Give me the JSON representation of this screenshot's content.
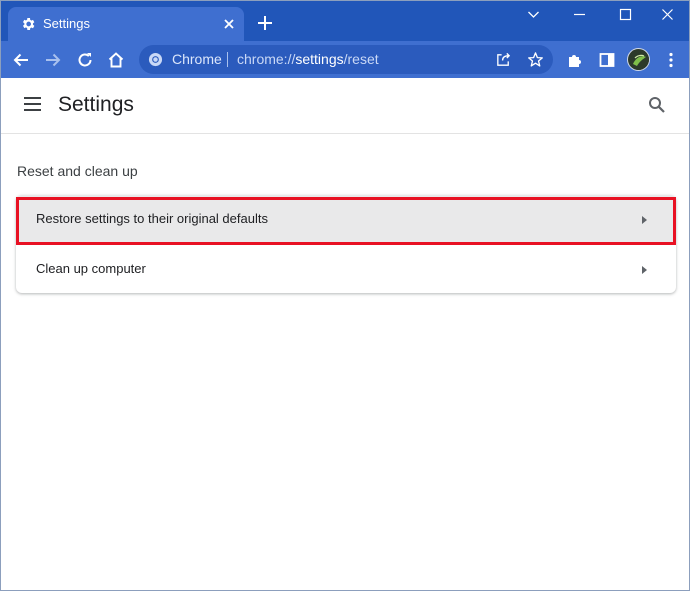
{
  "browser": {
    "tab": {
      "title": "Settings"
    },
    "omnibox": {
      "site_label": "Chrome",
      "url_prefix": "chrome://",
      "url_host": "settings",
      "url_path": "/reset"
    }
  },
  "settings": {
    "title": "Settings",
    "section_title": "Reset and clean up",
    "items": [
      {
        "label": "Restore settings to their original defaults"
      },
      {
        "label": "Clean up computer"
      }
    ]
  },
  "colors": {
    "tabstrip": "#2156b9",
    "toolbar": "#3f6fd0",
    "highlight": "#e81123"
  }
}
